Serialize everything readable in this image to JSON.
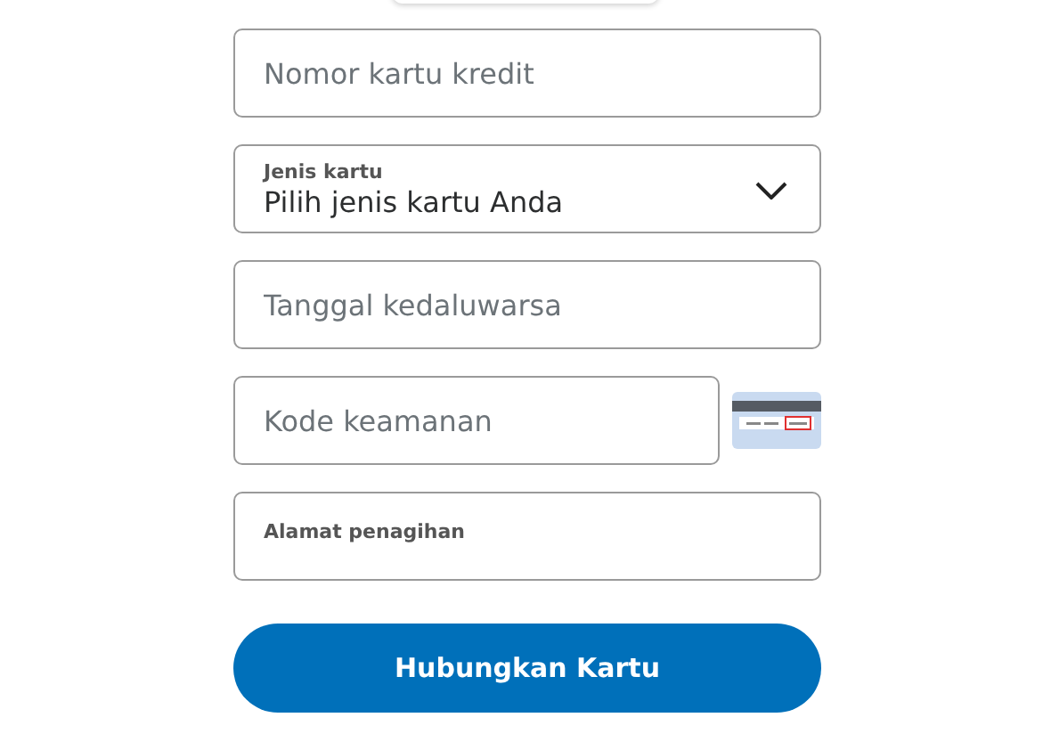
{
  "fields": [
    {
      "kind": "input",
      "placeholder": "Nomor kartu kredit"
    },
    {
      "kind": "select",
      "label": "Jenis kartu",
      "value": "Pilih jenis kartu Anda"
    },
    {
      "kind": "input",
      "placeholder": "Tanggal kedaluwarsa"
    },
    {
      "kind": "security",
      "placeholder": "Kode keamanan"
    },
    {
      "kind": "labeled",
      "label": "Alamat penagihan"
    }
  ],
  "submit_button": "Hubungkan Kartu"
}
